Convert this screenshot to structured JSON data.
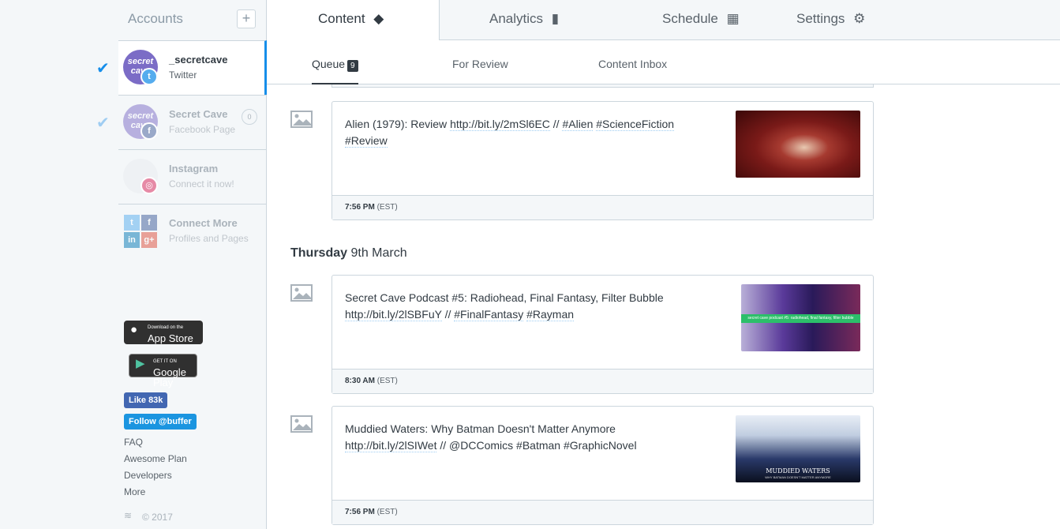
{
  "sidebar": {
    "header": "Accounts",
    "add_label": "+",
    "accounts": [
      {
        "name": "_secretcave",
        "type": "Twitter",
        "avatar_text": "secret cave"
      },
      {
        "name": "Secret Cave",
        "type": "Facebook Page",
        "avatar_text": "secret cave",
        "count": "0"
      },
      {
        "name": "Instagram",
        "type": "Connect it now!"
      },
      {
        "name": "Connect More",
        "type": "Profiles and Pages"
      }
    ],
    "connect_tiles": [
      "t",
      "f",
      "in",
      "g+"
    ],
    "app_store": {
      "small": "Download on the",
      "big": "App Store"
    },
    "google_play": {
      "small": "GET IT ON",
      "big": "Google Play"
    },
    "fb_like": "Like 83k",
    "tw_follow": "Follow @buffer",
    "links": [
      "FAQ",
      "Awesome Plan",
      "Developers",
      "More"
    ],
    "copyright": "© 2017"
  },
  "nav": {
    "tabs": [
      {
        "label": "Content",
        "icon": "layers-icon"
      },
      {
        "label": "Analytics",
        "icon": "bar-chart-icon"
      },
      {
        "label": "Schedule",
        "icon": "calendar-icon"
      },
      {
        "label": "Settings",
        "icon": "gear-icon"
      }
    ],
    "subtabs": [
      {
        "label": "Queue",
        "count": "9"
      },
      {
        "label": "For Review"
      },
      {
        "label": "Content Inbox"
      }
    ]
  },
  "queue": {
    "day_heading": {
      "weekday": "Thursday",
      "date": "9th March"
    },
    "posts": [
      {
        "text_a": "Alien (1979): Review ",
        "link": "http://bit.ly/2mSl6EC",
        "text_b": " //  ",
        "tags": [
          "#Alien",
          "#ScienceFiction",
          "#Review"
        ],
        "time": "7:56 PM",
        "tz": "(EST)"
      },
      {
        "text_a": "Secret Cave Podcast #5: Radiohead, Final Fantasy, Filter Bubble ",
        "link": "http://bit.ly/2lSBFuY",
        "text_b": " //  ",
        "tags": [
          "#FinalFantasy",
          "#Rayman"
        ],
        "time": "8:30 AM",
        "tz": "(EST)",
        "thumb_text": "secret cave podcast #5: radiohead, final fantasy, filter bubble"
      },
      {
        "text_a": "Muddied Waters: Why Batman Doesn't Matter Anymore ",
        "link": "http://bit.ly/2lSIWet",
        "text_b": " // @DCComics ",
        "tags": [
          "#Batman",
          "#GraphicNovel"
        ],
        "time": "7:56 PM",
        "tz": "(EST)",
        "thumb_title": "MUDDIED WATERS",
        "thumb_sub": "WHY BATMAN DOESN'T MATTER ANYMORE"
      }
    ]
  }
}
